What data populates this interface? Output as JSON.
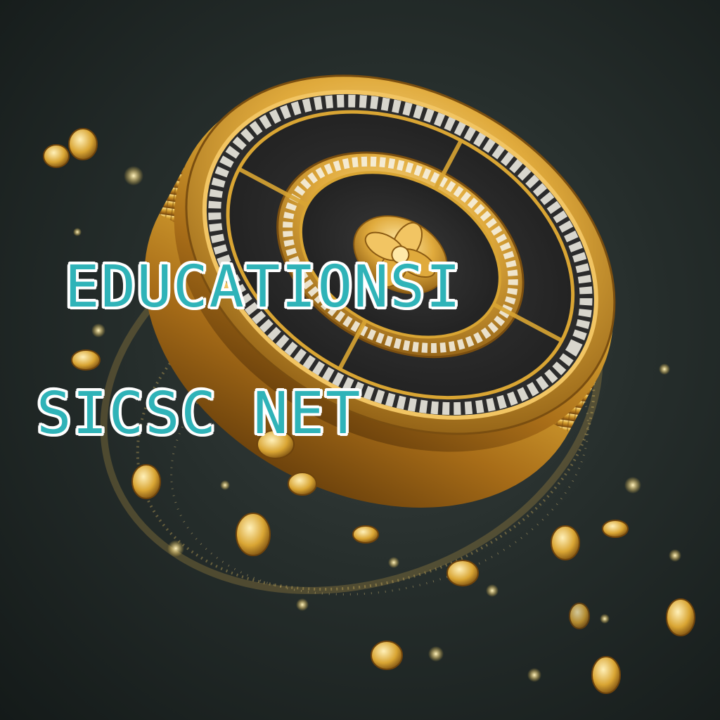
{
  "image": {
    "description_colors": {
      "background": "#1c2422",
      "gold": "#d9a533",
      "gold_dark": "#8a5a12",
      "gold_light": "#ffe08a",
      "dark_face": "#2b2b2b",
      "caption_fill": "#2fb3b8",
      "caption_outline": "#ffffff"
    }
  },
  "overlay": {
    "line1": "EDUCATIONSI",
    "line2": "SICSC NET"
  }
}
